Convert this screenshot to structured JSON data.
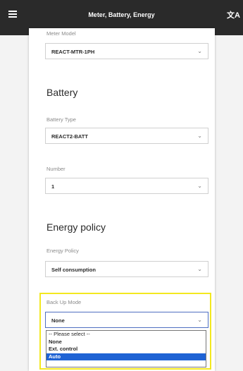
{
  "header": {
    "title": "Meter, Battery, Energy",
    "menu_icon": "hamburger-menu-icon",
    "language_icon": "translate-icon"
  },
  "meter": {
    "model_label": "Meter Model",
    "model_value": "REACT-MTR-1PH"
  },
  "battery": {
    "title": "Battery",
    "type_label": "Battery Type",
    "type_value": "REACT2-BATT",
    "number_label": "Number",
    "number_value": "1"
  },
  "energy": {
    "title": "Energy policy",
    "policy_label": "Energy Policy",
    "policy_value": "Self consumption",
    "backup_label": "Back Up Mode",
    "backup_value": "None",
    "backup_options": [
      "-- Please select --",
      "None",
      "Ext. control",
      "Auto"
    ],
    "backup_highlighted_option": "Auto"
  },
  "colors": {
    "header_bg": "#2a2a2a",
    "highlight_border": "#f3e81f",
    "selected_option": "#1f63d4"
  }
}
